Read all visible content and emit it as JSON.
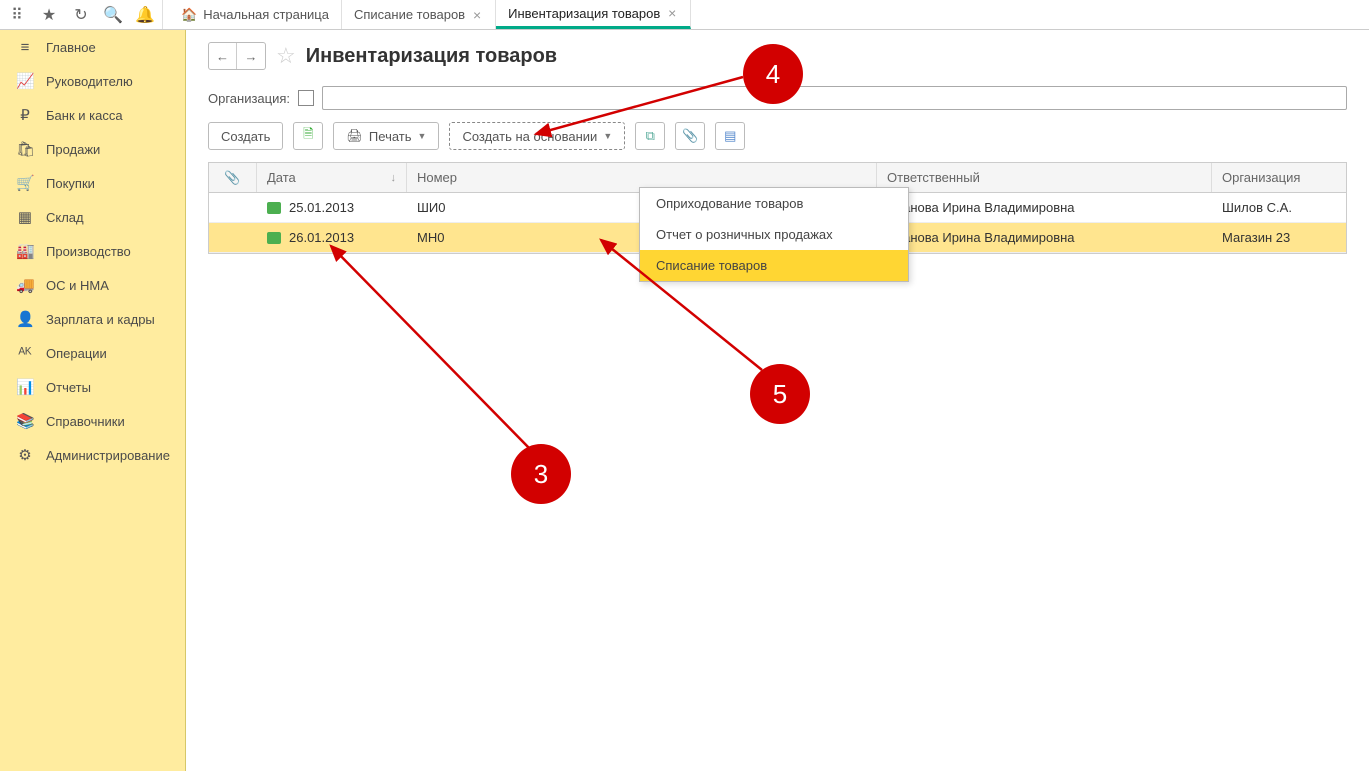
{
  "toolbar_icons": [
    "apps",
    "star",
    "history",
    "search",
    "bell"
  ],
  "tabs": {
    "home": "Начальная страница",
    "t1": "Списание товаров",
    "t2": "Инвентаризация товаров"
  },
  "sidebar": {
    "items": [
      {
        "icon": "≡",
        "label": "Главное"
      },
      {
        "icon": "📈",
        "label": "Руководителю"
      },
      {
        "icon": "₽",
        "label": "Банк и касса"
      },
      {
        "icon": "🛍",
        "label": "Продажи"
      },
      {
        "icon": "🛒",
        "label": "Покупки"
      },
      {
        "icon": "▦",
        "label": "Склад"
      },
      {
        "icon": "🏭",
        "label": "Производство"
      },
      {
        "icon": "🚚",
        "label": "ОС и НМА"
      },
      {
        "icon": "👤",
        "label": "Зарплата и кадры"
      },
      {
        "icon": "ᴬᴷ",
        "label": "Операции"
      },
      {
        "icon": "📊",
        "label": "Отчеты"
      },
      {
        "icon": "📚",
        "label": "Справочники"
      },
      {
        "icon": "⚙",
        "label": "Администрирование"
      }
    ]
  },
  "page": {
    "title": "Инвентаризация товаров",
    "org_label": "Организация:"
  },
  "buttons": {
    "create": "Создать",
    "print": "Печать",
    "create_based": "Создать на основании"
  },
  "table": {
    "headers": {
      "clip": "📎",
      "date": "Дата",
      "num": "Номер",
      "resp": "Ответственный",
      "org": "Организация"
    },
    "rows": [
      {
        "date": "25.01.2013",
        "num": "ШИ0",
        "resp": "Иванова Ирина Владимировна",
        "org": "Шилов С.А."
      },
      {
        "date": "26.01.2013",
        "num": "МН0",
        "resp": "Иванова Ирина Владимировна",
        "org": "Магазин 23"
      }
    ]
  },
  "dropdown": {
    "items": [
      "Оприходование товаров",
      "Отчет о розничных продажах",
      "Списание товаров"
    ]
  },
  "annotations": {
    "b3": "3",
    "b4": "4",
    "b5": "5"
  }
}
